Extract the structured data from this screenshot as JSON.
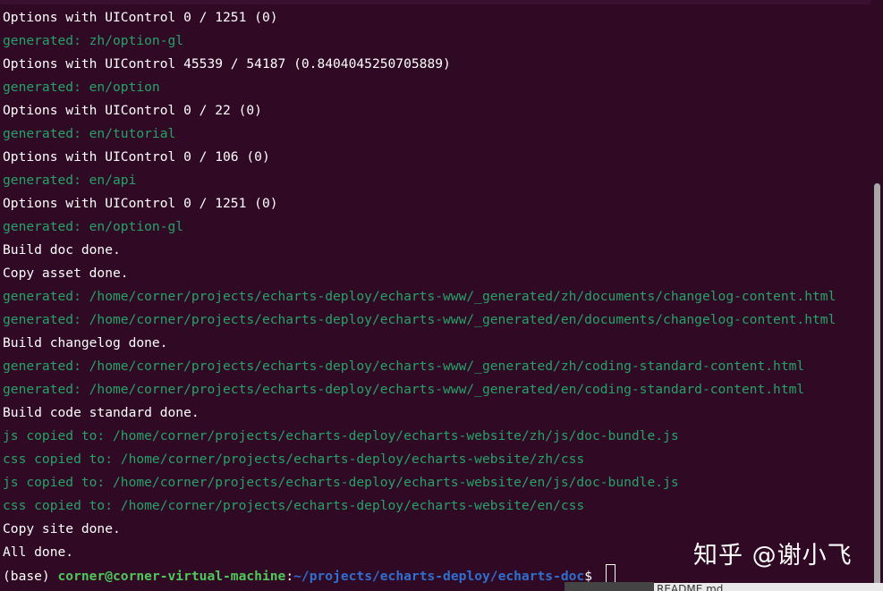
{
  "terminal": {
    "lines": [
      {
        "text": "Options with UIControl 0 / 1251 (0)",
        "color": "white"
      },
      {
        "text": "generated: zh/option-gl",
        "color": "green"
      },
      {
        "text": "Options with UIControl 45539 / 54187 (0.8404045250705889)",
        "color": "white"
      },
      {
        "text": "generated: en/option",
        "color": "green"
      },
      {
        "text": "Options with UIControl 0 / 22 (0)",
        "color": "white"
      },
      {
        "text": "generated: en/tutorial",
        "color": "green"
      },
      {
        "text": "Options with UIControl 0 / 106 (0)",
        "color": "white"
      },
      {
        "text": "generated: en/api",
        "color": "green"
      },
      {
        "text": "Options with UIControl 0 / 1251 (0)",
        "color": "white"
      },
      {
        "text": "generated: en/option-gl",
        "color": "green"
      },
      {
        "text": "Build doc done.",
        "color": "white"
      },
      {
        "text": "Copy asset done.",
        "color": "white"
      },
      {
        "text": "generated: /home/corner/projects/echarts-deploy/echarts-www/_generated/zh/documents/changelog-content.html",
        "color": "green"
      },
      {
        "text": "generated: /home/corner/projects/echarts-deploy/echarts-www/_generated/en/documents/changelog-content.html",
        "color": "green"
      },
      {
        "text": "Build changelog done.",
        "color": "white"
      },
      {
        "text": "generated: /home/corner/projects/echarts-deploy/echarts-www/_generated/zh/coding-standard-content.html",
        "color": "green"
      },
      {
        "text": "generated: /home/corner/projects/echarts-deploy/echarts-www/_generated/en/coding-standard-content.html",
        "color": "green"
      },
      {
        "text": "Build code standard done.",
        "color": "white"
      },
      {
        "text": "js copied to: /home/corner/projects/echarts-deploy/echarts-website/zh/js/doc-bundle.js",
        "color": "green"
      },
      {
        "text": "css copied to: /home/corner/projects/echarts-deploy/echarts-website/zh/css",
        "color": "green"
      },
      {
        "text": "js copied to: /home/corner/projects/echarts-deploy/echarts-website/en/js/doc-bundle.js",
        "color": "green"
      },
      {
        "text": "css copied to: /home/corner/projects/echarts-deploy/echarts-website/en/css",
        "color": "green"
      },
      {
        "text": "Copy site done.",
        "color": "white"
      },
      {
        "text": "All done.",
        "color": "white"
      }
    ],
    "prompt": {
      "env": "(base) ",
      "user_host": "corner@corner-virtual-machine",
      "separator": ":",
      "path": "~/projects/echarts-deploy/echarts-doc",
      "symbol": "$ "
    }
  },
  "background_window": {
    "file_label": "README.md"
  },
  "watermark": {
    "text": "知乎 @谢小飞"
  },
  "colors": {
    "background": "#300a24",
    "output_white": "#ffffff",
    "output_green": "#26a269",
    "prompt_user": "#4ec959",
    "prompt_path": "#2f6fd0"
  }
}
